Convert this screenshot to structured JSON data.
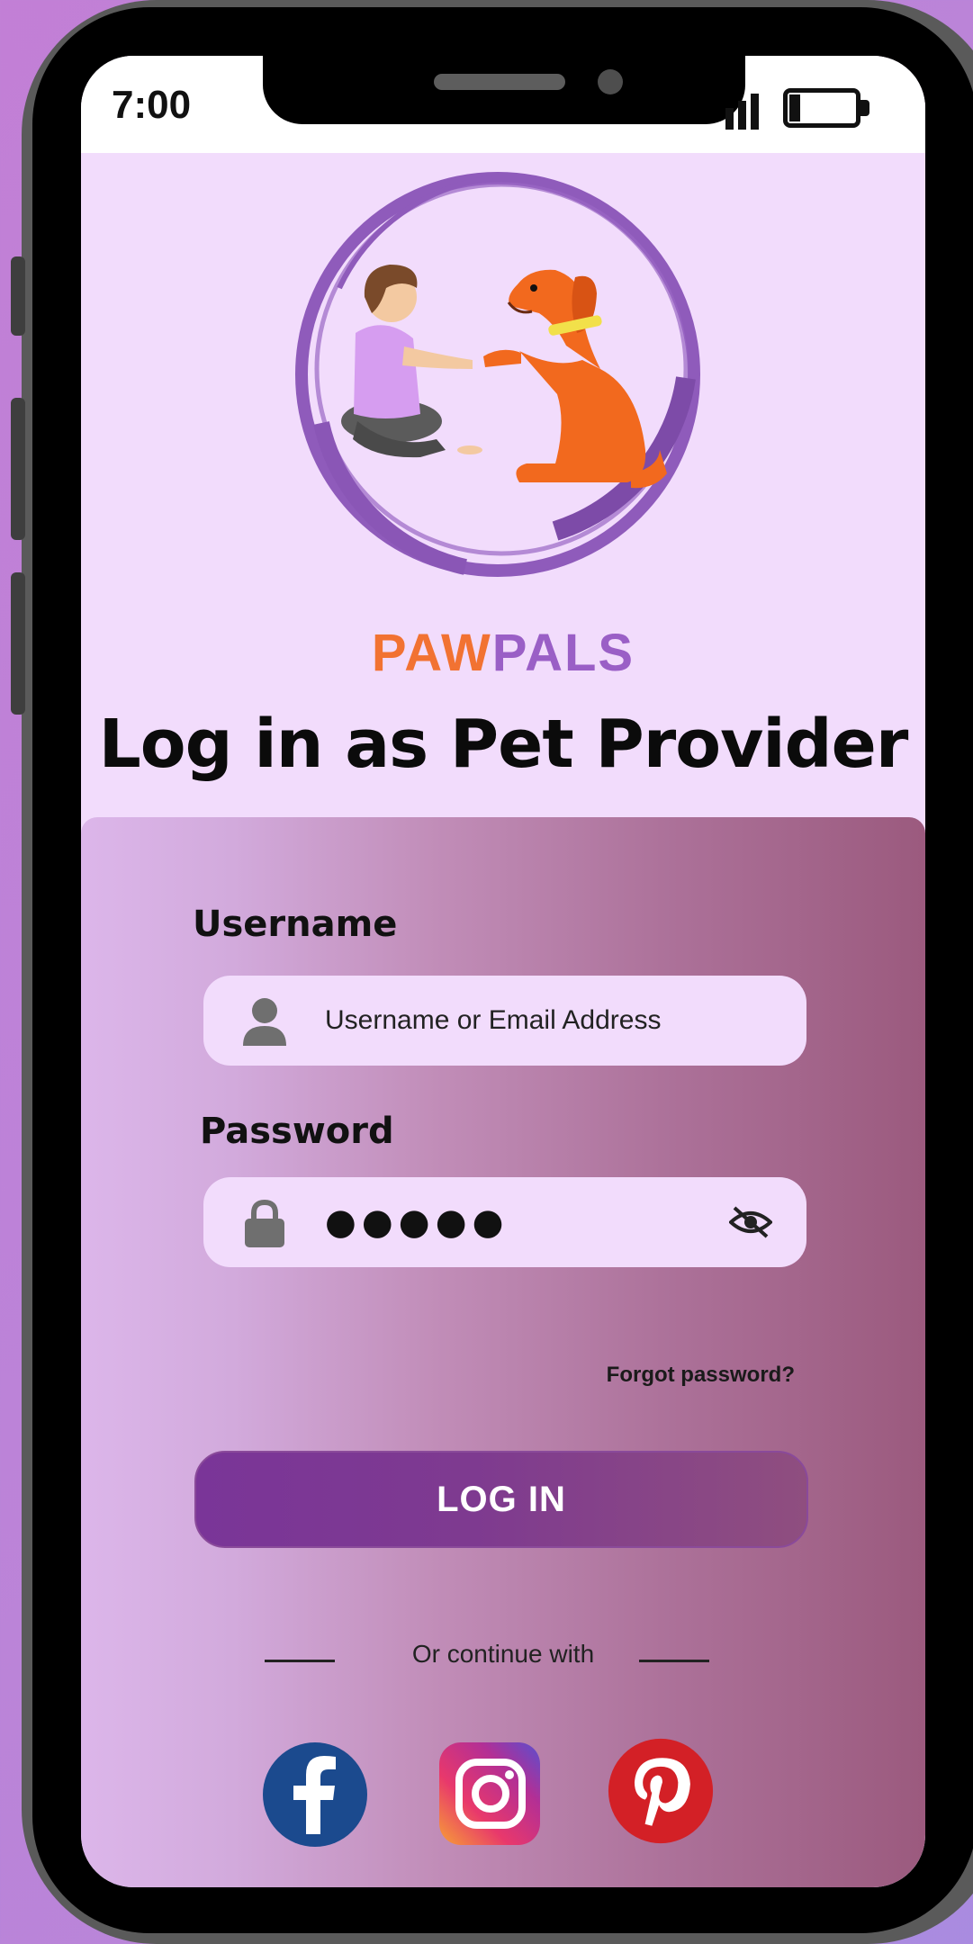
{
  "status_bar": {
    "time": "7:00"
  },
  "brand": {
    "part1": "PAW",
    "part2": "PALS",
    "color_paw": "#f27232",
    "color_pals": "#9a5fc6"
  },
  "page": {
    "title": "Log in as Pet Provider"
  },
  "form": {
    "username_label": "Username",
    "username_placeholder": "Username or Email Address",
    "password_label": "Password",
    "password_value": "●●●●●",
    "forgot_label": "Forgot password?",
    "login_label": "LOG IN"
  },
  "social": {
    "divider_text": "Or continue with",
    "icons": [
      "facebook-icon",
      "instagram-icon",
      "pinterest-icon"
    ]
  },
  "colors": {
    "accent": "#7a3598",
    "screen_bg": "#f2dcfc"
  }
}
